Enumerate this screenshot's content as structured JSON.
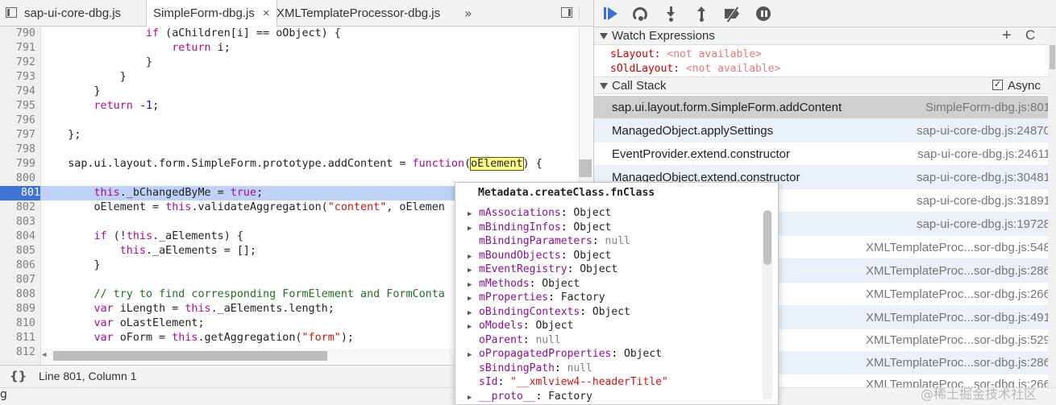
{
  "tabs": [
    {
      "label": "sap-ui-core-dbg.js",
      "active": false
    },
    {
      "label": "SimpleForm-dbg.js",
      "active": true,
      "close": "×"
    },
    {
      "label": "XMLTemplateProcessor-dbg.js",
      "active": false
    }
  ],
  "more_tabs": "»",
  "code_lines": [
    {
      "num": "790"
    },
    {
      "num": "791"
    },
    {
      "num": "792"
    },
    {
      "num": "793"
    },
    {
      "num": "794"
    },
    {
      "num": "795"
    },
    {
      "num": "796"
    },
    {
      "num": "797"
    },
    {
      "num": "798"
    },
    {
      "num": "799"
    },
    {
      "num": "800"
    },
    {
      "num": "801"
    },
    {
      "num": "802"
    },
    {
      "num": "803"
    },
    {
      "num": "804"
    },
    {
      "num": "805"
    },
    {
      "num": "806"
    },
    {
      "num": "807"
    },
    {
      "num": "808"
    },
    {
      "num": "809"
    },
    {
      "num": "810"
    },
    {
      "num": "811"
    },
    {
      "num": "812"
    }
  ],
  "code_text": {
    "l790": [
      "                ",
      "if",
      " (aChildren[i] == oObject) {"
    ],
    "l791": [
      "                    ",
      "return",
      " i;"
    ],
    "l792": [
      "                }"
    ],
    "l793": [
      "            }"
    ],
    "l794": [
      "        }"
    ],
    "l795": [
      "        ",
      "return",
      " ",
      "-1",
      ";"
    ],
    "l797": [
      "    };"
    ],
    "l799": [
      "    sap.ui.layout.form.SimpleForm.prototype.addContent = ",
      "function",
      "(",
      "oElement",
      ") {"
    ],
    "l801": [
      "        ",
      "this",
      "._bChangedByMe = ",
      "true",
      ";"
    ],
    "l802": [
      "        oElement = ",
      "this",
      ".validateAggregation(",
      "\"content\"",
      ", oElemen"
    ],
    "l804": [
      "        ",
      "if",
      " (!",
      "this",
      "._aElements) {"
    ],
    "l805": [
      "            ",
      "this",
      "._aElements = [];"
    ],
    "l806": [
      "        }"
    ],
    "l808": [
      "        ",
      "// try to find corresponding FormElement and FormConta"
    ],
    "l809": [
      "        ",
      "var",
      " iLength = ",
      "this",
      "._aElements.length;"
    ],
    "l810": [
      "        ",
      "var",
      " oLastElement;"
    ],
    "l811": [
      "        ",
      "var",
      " oForm = ",
      "this",
      ".getAggregation(",
      "\"form\"",
      ");"
    ]
  },
  "status": {
    "braces": "{}",
    "position": "Line 801, Column 1"
  },
  "bottom_fragment": "g",
  "debugger": {
    "watch_title": "Watch Expressions",
    "watch_add": "+",
    "watch_refresh": "C",
    "watch": [
      {
        "name": "sLayout",
        "value": "<not available>"
      },
      {
        "name": "sOldLayout",
        "value": "<not available>"
      }
    ],
    "callstack_title": "Call Stack",
    "async_label": "Async",
    "async_checked": "✓",
    "frames": [
      {
        "fn": "sap.ui.layout.form.SimpleForm.addContent",
        "loc": "SimpleForm-dbg.js:801"
      },
      {
        "fn": "ManagedObject.applySettings",
        "loc": "sap-ui-core-dbg.js:24870"
      },
      {
        "fn": "EventProvider.extend.constructor",
        "loc": "sap-ui-core-dbg.js:24611"
      },
      {
        "fn": "ManagedObject.extend.constructor",
        "loc": "sap-ui-core-dbg.js:30481"
      },
      {
        "fn": "",
        "loc": "sap-ui-core-dbg.js:31891"
      },
      {
        "fn": "",
        "loc": "sap-ui-core-dbg.js:19728"
      },
      {
        "fn": "",
        "loc": "XMLTemplateProc...sor-dbg.js:548"
      },
      {
        "fn": "",
        "loc": "XMLTemplateProc...sor-dbg.js:286"
      },
      {
        "fn": "",
        "loc": "XMLTemplateProc...sor-dbg.js:266"
      },
      {
        "fn": "",
        "loc": "XMLTemplateProc...sor-dbg.js:491"
      },
      {
        "fn": "",
        "loc": "XMLTemplateProc...sor-dbg.js:529"
      },
      {
        "fn": "",
        "loc": "XMLTemplateProc...sor-dbg.js:286"
      },
      {
        "fn": "",
        "loc": "XMLTemplateProc...sor-dbg.js:266"
      }
    ]
  },
  "popover": {
    "title": "Metadata.createClass.fnClass",
    "props": [
      {
        "arrow": "▶",
        "name": "mAssociations",
        "value": "Object"
      },
      {
        "arrow": "▶",
        "name": "mBindingInfos",
        "value": "Object"
      },
      {
        "arrow": "",
        "name": "mBindingParameters",
        "value": "null"
      },
      {
        "arrow": "▶",
        "name": "mBoundObjects",
        "value": "Object"
      },
      {
        "arrow": "▶",
        "name": "mEventRegistry",
        "value": "Object"
      },
      {
        "arrow": "▶",
        "name": "mMethods",
        "value": "Object"
      },
      {
        "arrow": "▶",
        "name": "mProperties",
        "value": "Factory"
      },
      {
        "arrow": "▶",
        "name": "oBindingContexts",
        "value": "Object"
      },
      {
        "arrow": "▶",
        "name": "oModels",
        "value": "Object"
      },
      {
        "arrow": "",
        "name": "oParent",
        "value": "null"
      },
      {
        "arrow": "▶",
        "name": "oPropagatedProperties",
        "value": "Object"
      },
      {
        "arrow": "",
        "name": "sBindingPath",
        "value": "null"
      },
      {
        "arrow": "",
        "name": "sId",
        "value": "\"__xmlview4--headerTitle\""
      },
      {
        "arrow": "▶",
        "name": "__proto__",
        "value": "Factory"
      }
    ]
  },
  "watermark": "@稀土掘金技术社区"
}
